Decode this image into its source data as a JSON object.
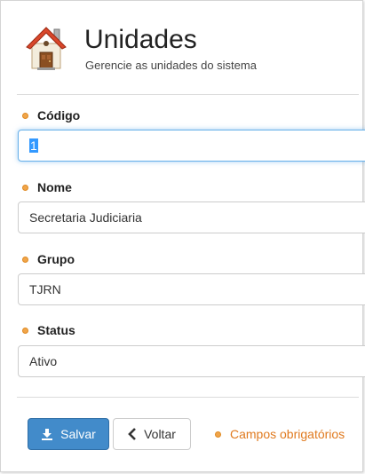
{
  "header": {
    "title": "Unidades",
    "subtitle": "Gerencie as unidades do sistema",
    "icon": "house-icon"
  },
  "form": {
    "codigo": {
      "label": "Código",
      "value": "1"
    },
    "nome": {
      "label": "Nome",
      "value": "Secretaria Judiciaria"
    },
    "grupo": {
      "label": "Grupo",
      "value": "TJRN"
    },
    "status": {
      "label": "Status",
      "value": "Ativo"
    }
  },
  "actions": {
    "save_label": "Salvar",
    "back_label": "Voltar",
    "required_note": "Campos obrigatórios"
  },
  "colors": {
    "accent": "#428bca",
    "required": "#e07a1f",
    "focus": "#66afe9"
  }
}
